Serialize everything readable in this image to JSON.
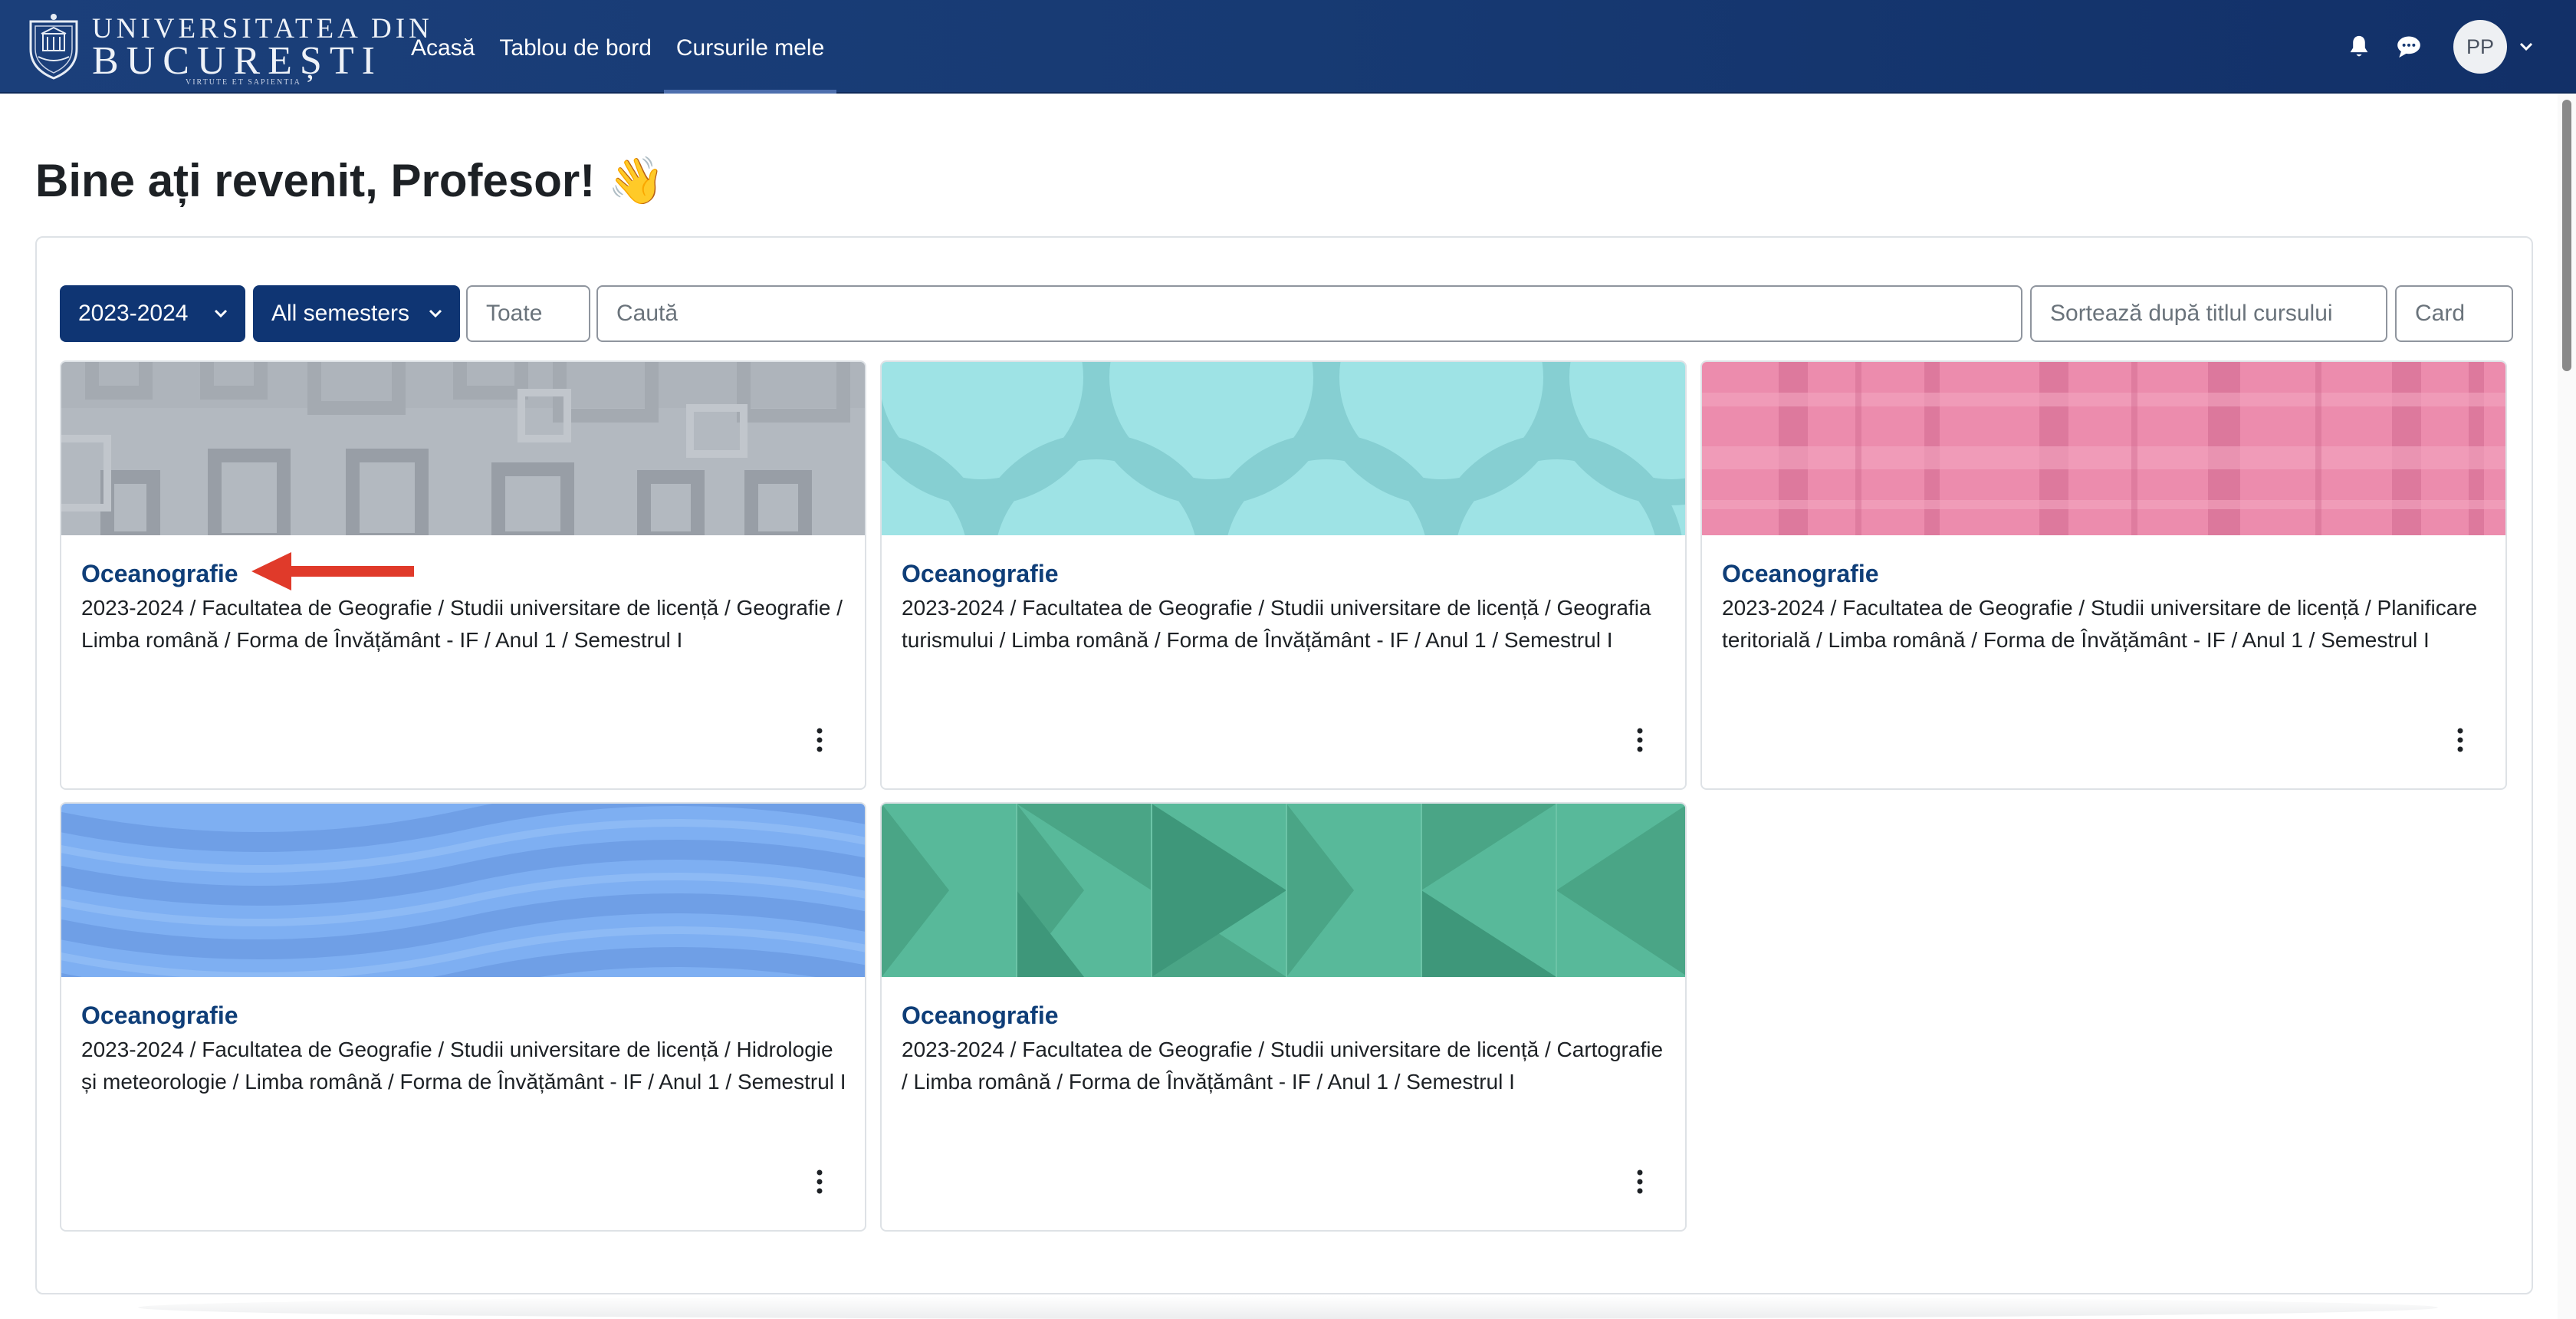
{
  "header": {
    "logo": {
      "line1": "UNIVERSITATEA DIN",
      "line2": "BUCUREȘTI",
      "line3": "VIRTUTE ET SAPIENTIA"
    },
    "nav": [
      {
        "label": "Acasă"
      },
      {
        "label": "Tablou de bord"
      },
      {
        "label": "Cursurile mele",
        "active": true
      }
    ],
    "user_initials": "PP",
    "icons": [
      "bell-icon",
      "chat-icon",
      "chevron-down-icon"
    ]
  },
  "page": {
    "title": "Bine ați revenit, Profesor! 👋"
  },
  "filters": {
    "year": "2023-2024",
    "semester": "All semesters",
    "grouping": "Toate",
    "search_placeholder": "Caută",
    "sort": "Sortează după titlul cursului",
    "view": "Card"
  },
  "colors": {
    "navbar": "#173a73",
    "primary_button": "#0f3573",
    "course_link": "#0f3e78",
    "annotation_arrow": "#e03a2a"
  },
  "courses": [
    {
      "title": "Oceanografie",
      "path": "2023-2024 / Facultatea de Geografie / Studii universitare de licență / Geografie / Limba română / Forma de Învățământ - IF / Anul 1 / Semestrul I",
      "pattern": "grey-squares"
    },
    {
      "title": "Oceanografie",
      "path": "2023-2024 / Facultatea de Geografie / Studii universitare de licență / Geografia turismului / Limba română / Forma de Învățământ - IF / Anul 1 / Semestrul I",
      "pattern": "teal-circles"
    },
    {
      "title": "Oceanografie",
      "path": "2023-2024 / Facultatea de Geografie / Studii universitare de licență / Planificare teritorială / Limba română / Forma de Învățământ - IF / Anul 1 / Semestrul I",
      "pattern": "pink-plaid"
    },
    {
      "title": "Oceanografie",
      "path": "2023-2024 / Facultatea de Geografie / Studii universitare de licență / Hidrologie și meteorologie / Limba română / Forma de Învățământ - IF / Anul 1 / Semestrul I",
      "pattern": "blue-waves"
    },
    {
      "title": "Oceanografie",
      "path": "2023-2024 / Facultatea de Geografie / Studii universitare de licență / Cartografie / Limba română / Forma de Învățământ - IF / Anul 1 / Semestrul I",
      "pattern": "green-triangles"
    }
  ]
}
